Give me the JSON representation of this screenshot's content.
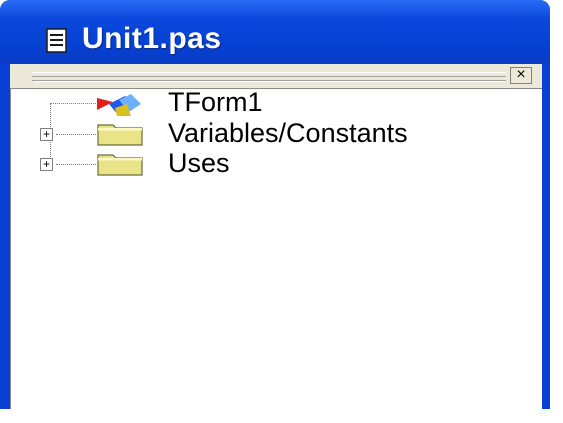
{
  "window": {
    "title": "Unit1.pas",
    "close_glyph": "×"
  },
  "tree": {
    "items": [
      {
        "label": "TForm1",
        "icon": "form-class-icon",
        "expandable": false
      },
      {
        "label": "Variables/Constants",
        "icon": "folder-icon",
        "expandable": true,
        "expander": "+"
      },
      {
        "label": "Uses",
        "icon": "folder-icon",
        "expandable": true,
        "expander": "+"
      }
    ]
  },
  "colors": {
    "titlebar": "#0541d2",
    "folder": "#e8e487",
    "panel": "#ece9d8"
  }
}
